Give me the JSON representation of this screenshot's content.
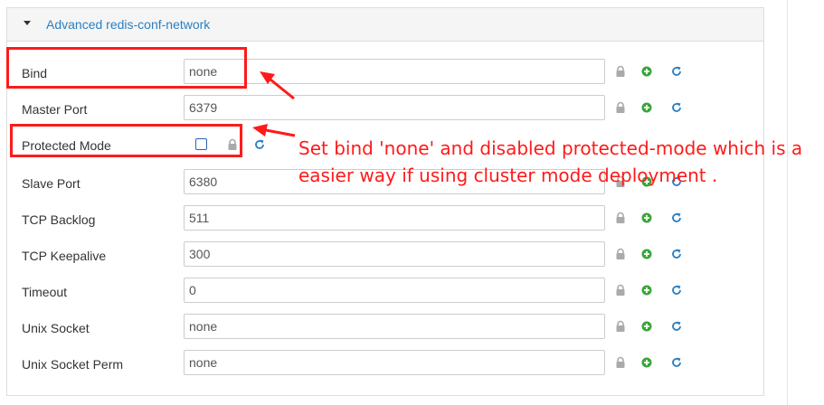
{
  "panel": {
    "title": "Advanced redis-conf-network",
    "collapse_icon": "caret-down-icon"
  },
  "fields": [
    {
      "label": "Bind",
      "type": "text",
      "value": "none"
    },
    {
      "label": "Master Port",
      "type": "text",
      "value": "6379"
    },
    {
      "label": "Protected Mode",
      "type": "checkbox",
      "checked": false
    },
    {
      "label": "Slave Port",
      "type": "text",
      "value": "6380"
    },
    {
      "label": "TCP Backlog",
      "type": "text",
      "value": "511"
    },
    {
      "label": "TCP Keepalive",
      "type": "text",
      "value": "300"
    },
    {
      "label": "Timeout",
      "type": "text",
      "value": "0"
    },
    {
      "label": "Unix Socket",
      "type": "text",
      "value": "none"
    },
    {
      "label": "Unix Socket Perm",
      "type": "text",
      "value": "none"
    }
  ],
  "row_icons": [
    "lock-icon",
    "plus-circle-icon",
    "refresh-icon"
  ],
  "annotation": {
    "text": "Set bind 'none' and disabled protected-mode which is a\neasier way if using cluster mode deployment ."
  },
  "colors": {
    "link": "#2a7fc1",
    "lock": "#aaaaaa",
    "plus": "#3aa53a",
    "refresh": "#2a7fc1",
    "annotation": "#ff1a1a",
    "checkbox_border": "#2a63b0"
  }
}
